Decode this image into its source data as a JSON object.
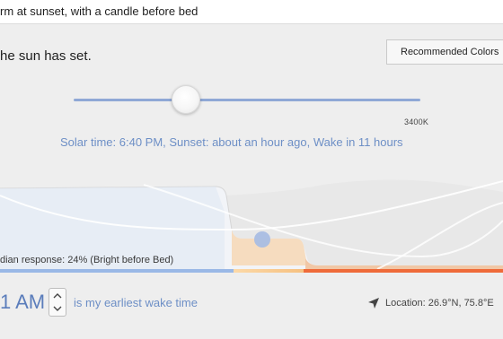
{
  "topbar": {
    "text": "rm at sunset, with a candle before bed"
  },
  "status": {
    "text": "he sun has set."
  },
  "recommended_colors_button": {
    "label": "Recommended Colors"
  },
  "slider": {
    "kelvin_label": "3400K"
  },
  "solar": {
    "text": "Solar time: 6:40 PM, Sunset: about an hour ago, Wake in 11 hours"
  },
  "circadian": {
    "label": "dian response: 24% (Bright before Bed)"
  },
  "wake": {
    "time": "1 AM",
    "caption": "is my earliest wake time",
    "stepper_up": "^",
    "stepper_down": "v"
  },
  "location": {
    "icon": "navigation-arrow-icon",
    "text": "Location: 26.9°N, 75.8°E"
  },
  "colors": {
    "accent_blue": "#6d8fc6",
    "orange": "#f6c07f",
    "red": "#ef6b3a"
  }
}
